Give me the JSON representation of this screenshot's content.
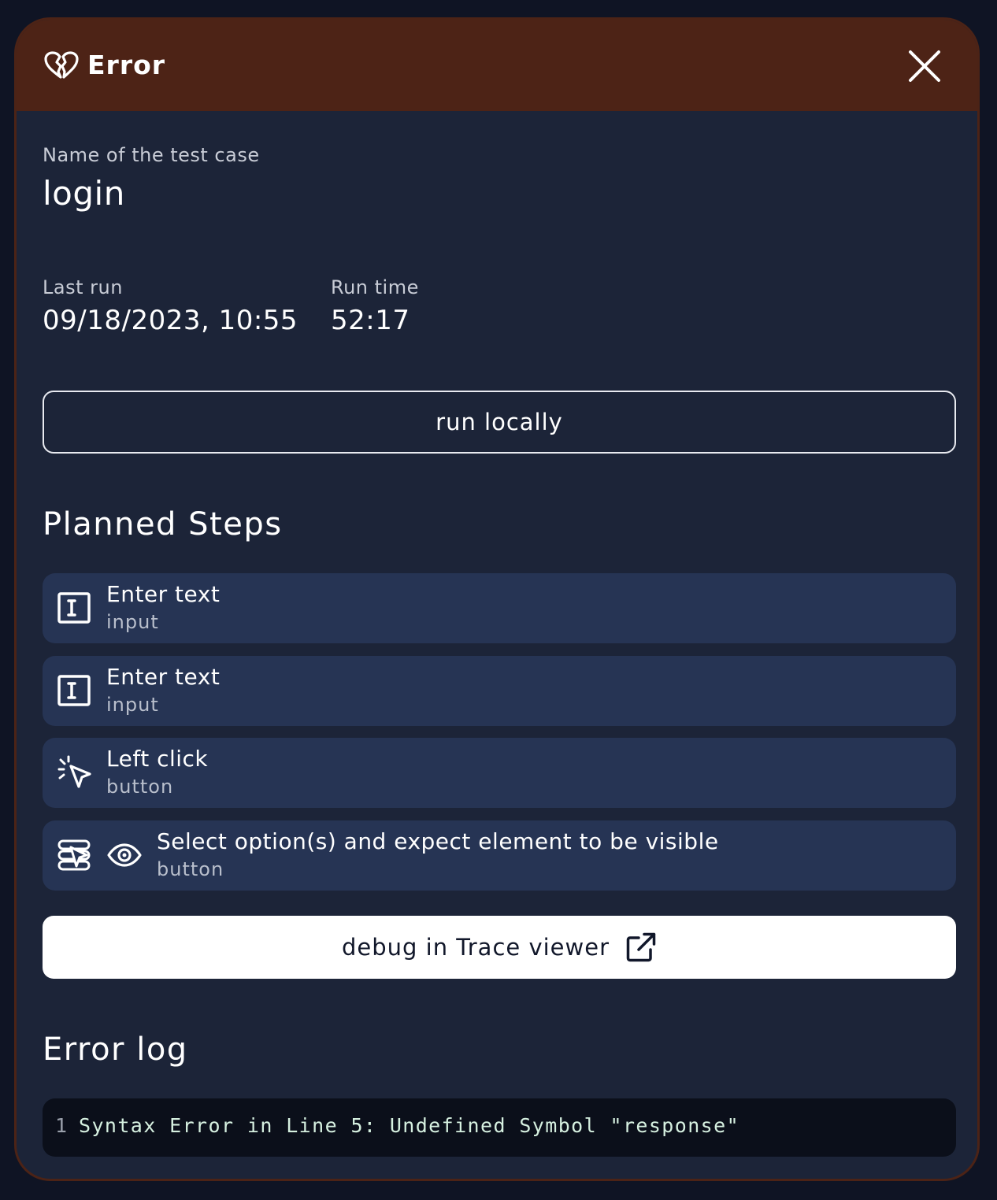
{
  "header": {
    "title": "Error",
    "icon": "broken-heart-icon",
    "close_icon": "close-icon",
    "background": "#4d2316"
  },
  "test_case": {
    "name_label": "Name of the test case",
    "name": "login"
  },
  "stats": {
    "last_run_label": "Last run",
    "last_run": "09/18/2023, 10:55",
    "run_time_label": "Run time",
    "run_time": "52:17"
  },
  "actions": {
    "run_locally": "run locally",
    "debug": "debug in Trace viewer",
    "debug_icon": "external-link-icon"
  },
  "planned_steps": {
    "title": "Planned Steps",
    "steps": [
      {
        "icon": "text-input-icon",
        "title": "Enter text",
        "subtitle": "input"
      },
      {
        "icon": "text-input-icon",
        "title": "Enter text",
        "subtitle": "input"
      },
      {
        "icon": "cursor-click-icon",
        "title": "Left click",
        "subtitle": "button"
      },
      {
        "icons": [
          "select-option-icon",
          "eye-icon"
        ],
        "title": "Select option(s) and expect element to be visible",
        "subtitle": "button"
      }
    ]
  },
  "error_log": {
    "title": "Error log",
    "lines": [
      {
        "number": "1",
        "text": "Syntax Error in Line 5: Undefined Symbol \"response\""
      }
    ]
  },
  "colors": {
    "modal_background": "#1c2438",
    "step_background": "#263454",
    "log_background": "#0b0f1a"
  }
}
